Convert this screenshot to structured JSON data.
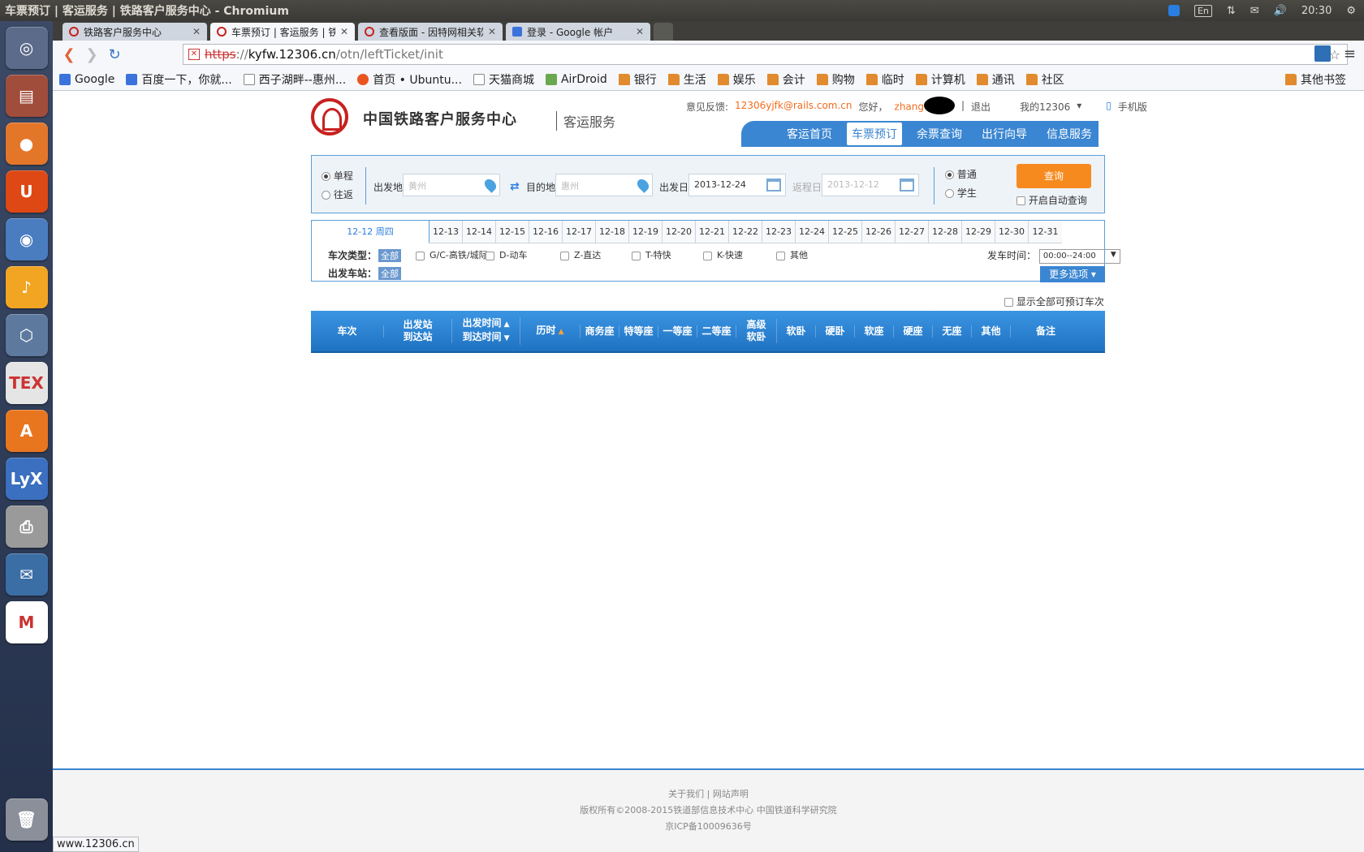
{
  "os_panel": {
    "window_title": "车票预订 | 客运服务 | 铁路客户服务中心 - Chromium",
    "keyboard_layout": "En",
    "clock": "20:30",
    "indicator_icons": [
      "skype-icon",
      "keyboard-icon",
      "network-icon",
      "mail-icon",
      "volume-icon",
      "clock",
      "gear-icon"
    ]
  },
  "launcher": [
    {
      "name": "dash-home-icon",
      "color": "#5c6b8a",
      "glyph": "◎"
    },
    {
      "name": "files-icon",
      "color": "#a14d3b",
      "glyph": "▤"
    },
    {
      "name": "firefox-icon",
      "color": "#e4762a",
      "glyph": "●"
    },
    {
      "name": "ubuntu-one-icon",
      "color": "#dd4814",
      "glyph": "U"
    },
    {
      "name": "chromium-icon",
      "color": "#4a7cc0",
      "glyph": "◉"
    },
    {
      "name": "audacity-icon",
      "color": "#f2a523",
      "glyph": "♪"
    },
    {
      "name": "virtualbox-icon",
      "color": "#5d7a9e",
      "glyph": "⬡"
    },
    {
      "name": "texmaker-icon",
      "color": "#e5e5e5",
      "glyph": "TEX"
    },
    {
      "name": "software-center-icon",
      "color": "#e8761f",
      "glyph": "A"
    },
    {
      "name": "lyx-icon",
      "color": "#3b6fbf",
      "glyph": "LyX"
    },
    {
      "name": "printer-icon",
      "color": "#9a9a9a",
      "glyph": "⎙"
    },
    {
      "name": "thunderbird-icon",
      "color": "#3c6ea6",
      "glyph": "✉"
    },
    {
      "name": "gmail-icon",
      "color": "#ffffff",
      "glyph": "M"
    }
  ],
  "tabs": [
    {
      "title": "铁路客户服务中心",
      "icon": "railway-icon",
      "active": false
    },
    {
      "title": "车票预订 | 客运服务 | 铁路:",
      "icon": "railway-icon",
      "active": true
    },
    {
      "title": "查看版面 - 因特网相关软件",
      "icon": "forum-icon",
      "active": false
    },
    {
      "title": "登录 - Google 帐户",
      "icon": "google-icon",
      "active": false
    }
  ],
  "omnibox": {
    "scheme": "https",
    "separator": "://",
    "host": "kyfw.12306.cn",
    "path": "/otn/leftTicket/init"
  },
  "bookmarks": [
    {
      "label": "Google",
      "icon": "google-icon"
    },
    {
      "label": "百度一下，你就...",
      "icon": "baidu-icon"
    },
    {
      "label": "西子湖畔--惠州...",
      "icon": "page-icon"
    },
    {
      "label": "首页 • Ubuntu...",
      "icon": "ubuntu-icon"
    },
    {
      "label": "天猫商城",
      "icon": "page-icon"
    },
    {
      "label": "AirDroid",
      "icon": "airdroid-icon"
    },
    {
      "label": "银行",
      "icon": "folder-icon"
    },
    {
      "label": "生活",
      "icon": "folder-icon"
    },
    {
      "label": "娱乐",
      "icon": "folder-icon"
    },
    {
      "label": "会计",
      "icon": "folder-icon"
    },
    {
      "label": "购物",
      "icon": "folder-icon"
    },
    {
      "label": "临时",
      "icon": "folder-icon"
    },
    {
      "label": "计算机",
      "icon": "folder-icon"
    },
    {
      "label": "通讯",
      "icon": "folder-icon"
    },
    {
      "label": "社区",
      "icon": "folder-icon"
    }
  ],
  "bookmarks_other": "其他书签",
  "site": {
    "name": "中国铁路客户服务中心",
    "sub": "客运服务",
    "feedback_label": "意见反馈:",
    "feedback_email": "12306yjfk@rails.com.cn",
    "greeting": "您好，",
    "user": "zhang",
    "logout": "退出",
    "my12306": "我的12306",
    "mobile": "手机版",
    "nav": [
      "客运首页",
      "车票预订",
      "余票查询",
      "出行向导",
      "信息服务"
    ],
    "nav_active_index": 1
  },
  "search": {
    "one_way": "单程",
    "round_trip": "往返",
    "from_label": "出发地",
    "from_value": "黄州",
    "to_label": "目的地",
    "to_value": "惠州",
    "depart_label": "出发日",
    "depart_value": "2013-12-24",
    "return_label": "返程日",
    "return_value": "2013-12-12",
    "normal": "普通",
    "student": "学生",
    "query_button": "查询",
    "auto_query": "开启自动查询"
  },
  "dates": {
    "active": "12-12 周四",
    "list": [
      "12-13",
      "12-14",
      "12-15",
      "12-16",
      "12-17",
      "12-18",
      "12-19",
      "12-20",
      "12-21",
      "12-22",
      "12-23",
      "12-24",
      "12-25",
      "12-26",
      "12-27",
      "12-28",
      "12-29",
      "12-30",
      "12-31"
    ]
  },
  "filters": {
    "train_type_label": "车次类型：",
    "all": "全部",
    "types": [
      "G/C-高铁/城际",
      "D-动车",
      "Z-直达",
      "T-特快",
      "K-快速",
      "其他"
    ],
    "station_label": "出发车站：",
    "time_label": "发车时间：",
    "time_value": "00:00--24:00",
    "more_options": "更多选项"
  },
  "show_all": "显示全部可预订车次",
  "table_columns": [
    {
      "l1": "车次",
      "l2": ""
    },
    {
      "l1": "出发站",
      "l2": "到达站"
    },
    {
      "l1": "出发时间",
      "l2": "到达时间"
    },
    {
      "l1": "历时",
      "l2": ""
    },
    {
      "l1": "商务座",
      "l2": ""
    },
    {
      "l1": "特等座",
      "l2": ""
    },
    {
      "l1": "一等座",
      "l2": ""
    },
    {
      "l1": "二等座",
      "l2": ""
    },
    {
      "l1": "高级",
      "l2": "软卧"
    },
    {
      "l1": "软卧",
      "l2": ""
    },
    {
      "l1": "硬卧",
      "l2": ""
    },
    {
      "l1": "软座",
      "l2": ""
    },
    {
      "l1": "硬座",
      "l2": ""
    },
    {
      "l1": "无座",
      "l2": ""
    },
    {
      "l1": "其他",
      "l2": ""
    },
    {
      "l1": "备注",
      "l2": ""
    }
  ],
  "footer": {
    "about": "关于我们",
    "separator": "|",
    "statement": "网站声明",
    "copyright": "版权所有©2008-2015铁道部信息技术中心  中国铁道科学研究院",
    "icp": "京ICP备10009636号"
  },
  "status_bubble": "www.12306.cn"
}
